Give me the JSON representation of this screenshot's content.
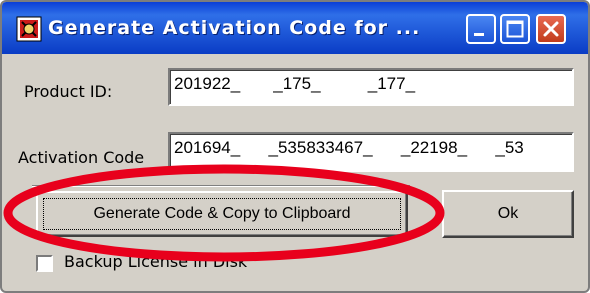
{
  "window": {
    "title": "Generate Activation Code for ...",
    "icon": "app-icon"
  },
  "titlebar_buttons": {
    "minimize": "minimize-icon",
    "maximize": "maximize-icon",
    "close": "close-icon"
  },
  "form": {
    "product_id_label": "Product ID:",
    "product_id_value": "201922_       _175_          _177_",
    "activation_code_label": "Activation Code",
    "activation_code_value": "201694_      _535833467_      _22198_      _53"
  },
  "buttons": {
    "generate_label": "Generate Code & Copy to Clipboard",
    "ok_label": "Ok"
  },
  "checkbox": {
    "label": "Backup License in Disk",
    "checked": false
  },
  "colors": {
    "titlebar": "#0b3fd6",
    "face": "#d4d0c8",
    "highlight_ellipse": "#e8001c"
  }
}
